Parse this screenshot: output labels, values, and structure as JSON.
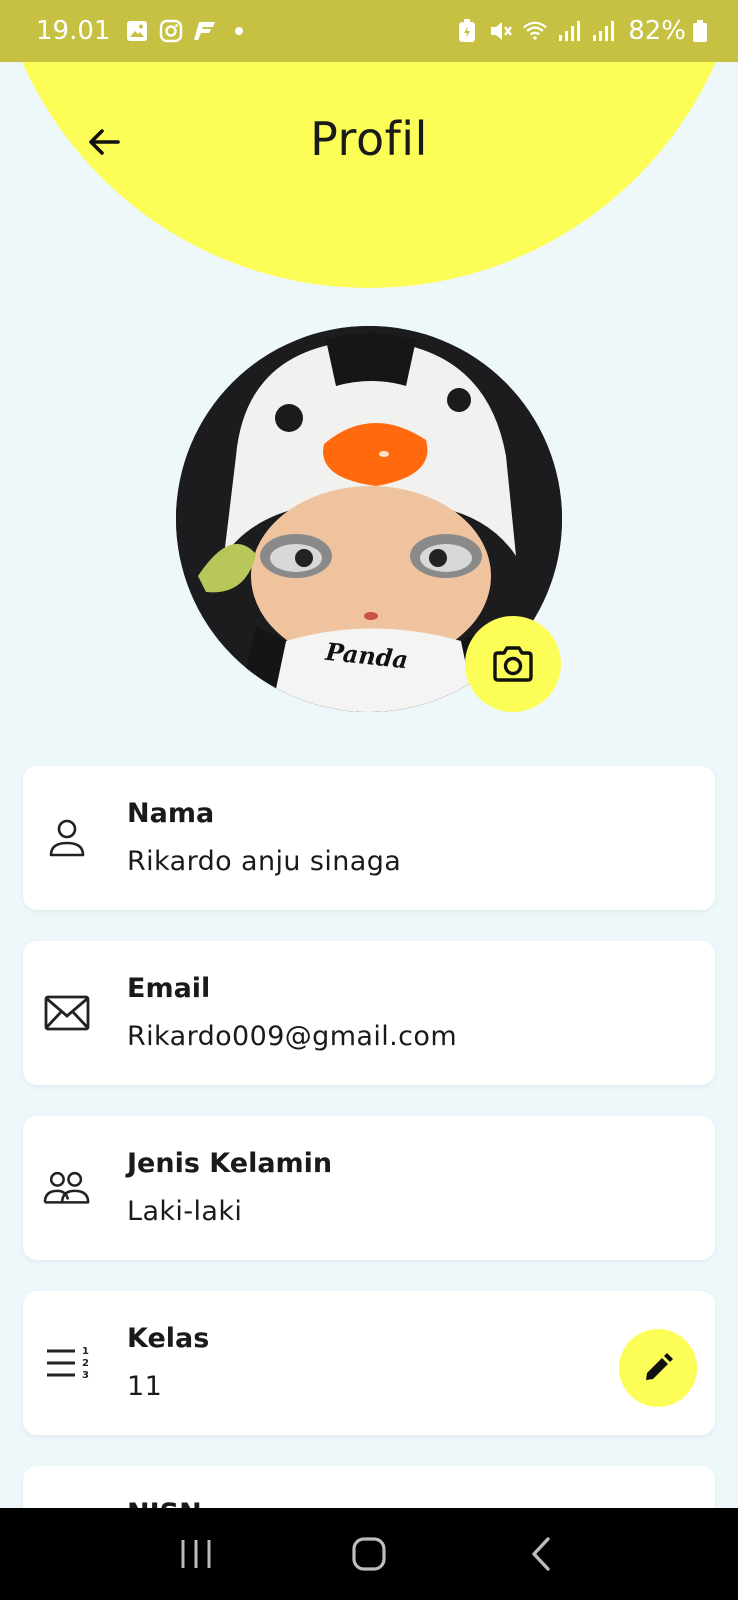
{
  "status_bar": {
    "time": "19.01",
    "battery": "82%",
    "left_icons": [
      "gallery-icon",
      "instagram-icon",
      "app-f-icon",
      "dot-icon"
    ],
    "right_icons": [
      "battery-saver-icon",
      "mute-icon",
      "wifi-icon",
      "signal-icon",
      "signal-icon",
      "battery-icon"
    ]
  },
  "app_bar": {
    "title": "Profil",
    "back_icon": "arrow-left-icon"
  },
  "avatar": {
    "badge_text": "Panda",
    "camera_icon": "camera-icon"
  },
  "fields": [
    {
      "icon": "person-icon",
      "label": "Nama",
      "value": "Rikardo anju sinaga"
    },
    {
      "icon": "envelope-icon",
      "label": "Email",
      "value": "Rikardo009@gmail.com"
    },
    {
      "icon": "people-icon",
      "label": "Jenis Kelamin",
      "value": "Laki-laki"
    },
    {
      "icon": "ordered-list-icon",
      "label": "Kelas",
      "value": "11",
      "edit_icon": "pencil-icon"
    },
    {
      "label": "NISN"
    }
  ],
  "colors": {
    "accent": "#fdfd57",
    "status_bar": "#c6c142",
    "background": "#eef8fb",
    "card": "#ffffff"
  },
  "nav_bar": {
    "icons": [
      "recent-apps-icon",
      "home-icon",
      "back-icon"
    ]
  }
}
